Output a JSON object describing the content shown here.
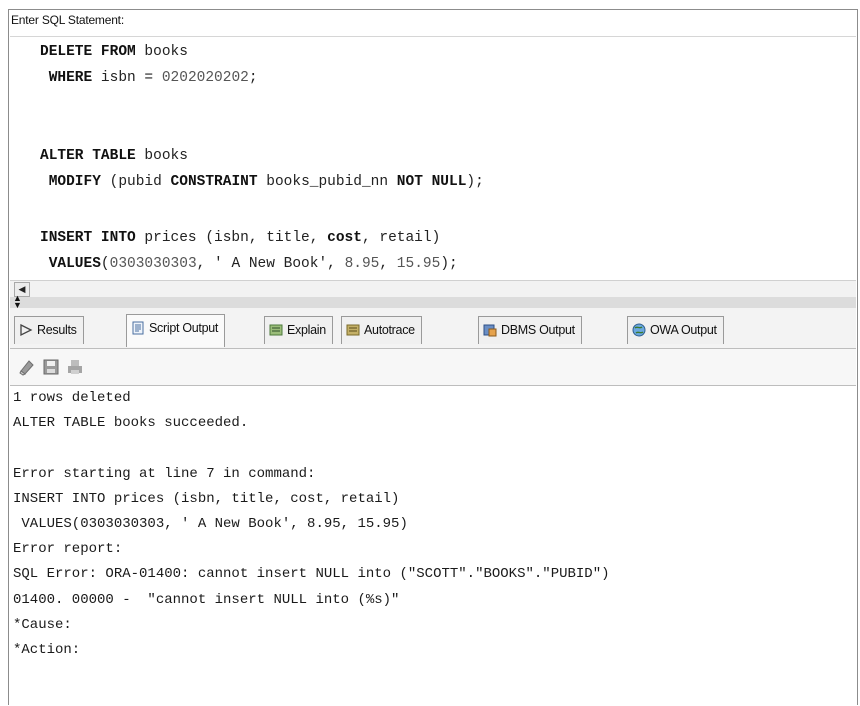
{
  "editor": {
    "prompt_label": "Enter SQL Statement:",
    "lines": [
      [
        {
          "t": "DELETE FROM",
          "k": "kw"
        },
        {
          "t": " books",
          "k": ""
        }
      ],
      [
        {
          "t": " WHERE",
          "k": "kw"
        },
        {
          "t": " isbn = ",
          "k": ""
        },
        {
          "t": "0202020202",
          "k": "num"
        },
        {
          "t": ";",
          "k": ""
        }
      ],
      [],
      [
        {
          "t": "ALTER TABLE",
          "k": "kw"
        },
        {
          "t": " books",
          "k": ""
        }
      ],
      [
        {
          "t": " MODIFY",
          "k": "kw"
        },
        {
          "t": " (pubid ",
          "k": ""
        },
        {
          "t": "CONSTRAINT",
          "k": "kw"
        },
        {
          "t": " books_pubid_nn ",
          "k": ""
        },
        {
          "t": "NOT NULL",
          "k": "kw"
        },
        {
          "t": ");",
          "k": ""
        }
      ],
      [],
      [
        {
          "t": "INSERT INTO",
          "k": "kw"
        },
        {
          "t": " prices (isbn, title, ",
          "k": ""
        },
        {
          "t": "cost",
          "k": "kw"
        },
        {
          "t": ", retail)",
          "k": ""
        }
      ],
      [
        {
          "t": " VALUES",
          "k": "kw"
        },
        {
          "t": "(",
          "k": ""
        },
        {
          "t": "0303030303",
          "k": "num"
        },
        {
          "t": ", ' A New Book', ",
          "k": ""
        },
        {
          "t": "8.95",
          "k": "num"
        },
        {
          "t": ", ",
          "k": ""
        },
        {
          "t": "15.95",
          "k": "num"
        },
        {
          "t": ");",
          "k": ""
        }
      ]
    ]
  },
  "tabs": [
    {
      "label": "Results",
      "icon": "play-triangle-icon",
      "active": false
    },
    {
      "label": "Script Output",
      "icon": "script-document-icon",
      "active": true
    },
    {
      "label": "Explain",
      "icon": "explain-plan-icon",
      "active": false
    },
    {
      "label": "Autotrace",
      "icon": "autotrace-icon",
      "active": false
    },
    {
      "label": "DBMS Output",
      "icon": "dbms-output-icon",
      "active": false
    },
    {
      "label": "OWA Output",
      "icon": "owa-globe-icon",
      "active": false
    }
  ],
  "toolbar": {
    "icons": [
      "eraser-icon",
      "save-disk-icon",
      "print-icon"
    ]
  },
  "output": {
    "lines": [
      "1 rows deleted",
      "ALTER TABLE books succeeded.",
      "",
      "Error starting at line 7 in command:",
      "INSERT INTO prices (isbn, title, cost, retail)",
      " VALUES(0303030303, ' A New Book', 8.95, 15.95)",
      "Error report:",
      "SQL Error: ORA-01400: cannot insert NULL into (\"SCOTT\".\"BOOKS\".\"PUBID\")",
      "01400. 00000 -  \"cannot insert NULL into (%s)\"",
      "*Cause:",
      "*Action:"
    ]
  }
}
